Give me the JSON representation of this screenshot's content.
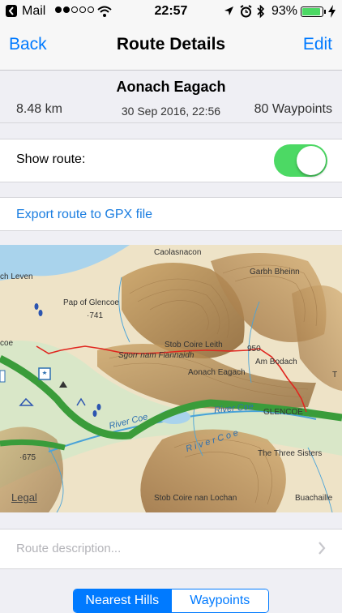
{
  "status_bar": {
    "carrier": "Mail",
    "time": "22:57",
    "battery": "93%",
    "battery_level": 0.93
  },
  "nav": {
    "back_label": "Back",
    "title": "Route Details",
    "edit_label": "Edit"
  },
  "route": {
    "name": "Aonach Eagach",
    "distance": "8.48 km",
    "date": "30 Sep 2016, 22:56",
    "waypoints": "80 Waypoints"
  },
  "show_route": {
    "label": "Show route:",
    "on": true
  },
  "export": {
    "label": "Export route to GPX file"
  },
  "map": {
    "labels": {
      "caolasnacon": "Caolasnacon",
      "garbh_bheinn": "Garbh Bheinn",
      "loch_leven": "ch Leven",
      "pap_of_glencoe": "Pap of Glencoe",
      "spot_741": "·741",
      "stob_coire_leith": "Stob Coire Leith",
      "spot_950": "950",
      "sgorr_nam_fiannaidh": "Sgorr nam Fiannaidh",
      "am_bodach": "Am Bodach",
      "aonach_eagach": "Aonach Eagach",
      "coe": "coe",
      "river_coe_1": "River Coe",
      "river_coe_2": "River Coe",
      "glencoe": "GLENCOE",
      "river_coe_3": "R i v e r  C o e",
      "spot_675": "·675",
      "the_three_sisters": "The Three Sisters",
      "stob_coire_nan_lochan": "Stob Coire nan Lochan",
      "buachaille": "Buachaille",
      "edge_t": "T"
    },
    "legal": "Legal"
  },
  "description": {
    "placeholder": "Route description..."
  },
  "segments": {
    "nearest_hills": "Nearest Hills",
    "waypoints": "Waypoints"
  },
  "colors": {
    "accent": "#007aff",
    "switch_on": "#4cd964",
    "route_line": "#e0261f",
    "road": "#3a9c3a",
    "water": "#a9d3ec"
  }
}
